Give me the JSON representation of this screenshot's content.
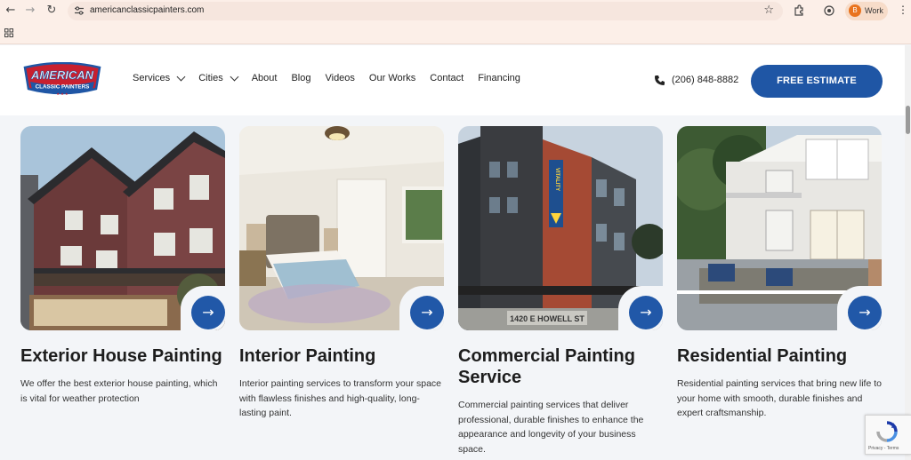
{
  "browser": {
    "url": "americanclassicpainters.com",
    "profile_initial": "B",
    "profile_label": "Work"
  },
  "header": {
    "logo_text_top": "AMERICAN",
    "logo_text_bottom": "CLASSIC PAINTERS",
    "nav": [
      {
        "label": "Services",
        "dropdown": true
      },
      {
        "label": "Cities",
        "dropdown": true
      },
      {
        "label": "About",
        "dropdown": false
      },
      {
        "label": "Blog",
        "dropdown": false
      },
      {
        "label": "Videos",
        "dropdown": false
      },
      {
        "label": "Our Works",
        "dropdown": false
      },
      {
        "label": "Contact",
        "dropdown": false
      },
      {
        "label": "Financing",
        "dropdown": false
      }
    ],
    "phone": "(206) 848-8882",
    "cta_label": "FREE ESTIMATE"
  },
  "cards": [
    {
      "title": "Exterior House Painting",
      "description": "We offer the best exterior house painting, which is vital for weather protection"
    },
    {
      "title": "Interior Painting",
      "description": "Interior painting services to transform your space with flawless finishes and high-quality, long-lasting paint."
    },
    {
      "title": "Commercial Painting Service",
      "description": "Commercial painting services that deliver professional, durable finishes to enhance the appearance and longevity of your business space."
    },
    {
      "title": "Residential Painting",
      "description": "Residential painting services that bring new life to your home with smooth, durable finishes and expert craftsmanship."
    }
  ],
  "commercial_sign": "1420 E HOWELL ST",
  "recaptcha_text": "Privacy - Terms",
  "colors": {
    "brand_blue": "#1f56a5",
    "brand_red": "#c8202f"
  }
}
